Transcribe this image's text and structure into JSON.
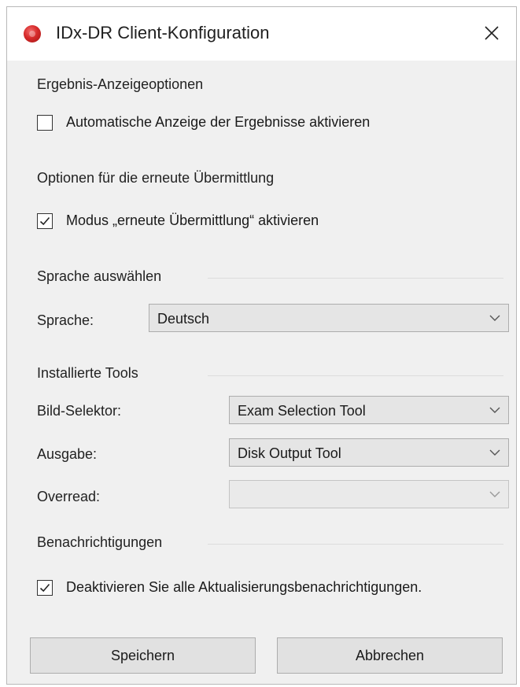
{
  "window": {
    "title": "IDx-DR Client-Konfiguration",
    "close_icon": "close-icon"
  },
  "results": {
    "heading": "Ergebnis-Anzeigeoptionen",
    "auto_display_label": "Automatische Anzeige der Ergebnisse aktivieren",
    "auto_display_checked": false
  },
  "resubmit": {
    "heading": "Optionen für die erneute Übermittlung",
    "mode_label": "Modus „erneute Übermittlung“ aktivieren",
    "mode_checked": true
  },
  "language": {
    "heading": "Sprache auswählen",
    "label": "Sprache:",
    "value": "Deutsch"
  },
  "tools": {
    "heading": "Installierte Tools",
    "image_selector_label": "Bild-Selektor:",
    "image_selector_value": "Exam Selection Tool",
    "output_label": "Ausgabe:",
    "output_value": "Disk Output Tool",
    "overread_label": "Overread:",
    "overread_value": ""
  },
  "notifications": {
    "heading": "Benachrichtigungen",
    "disable_updates_label": "Deaktivieren Sie alle Aktualisierungsbenachrichtigungen.",
    "disable_updates_checked": true
  },
  "buttons": {
    "save": "Speichern",
    "cancel": "Abbrechen"
  }
}
